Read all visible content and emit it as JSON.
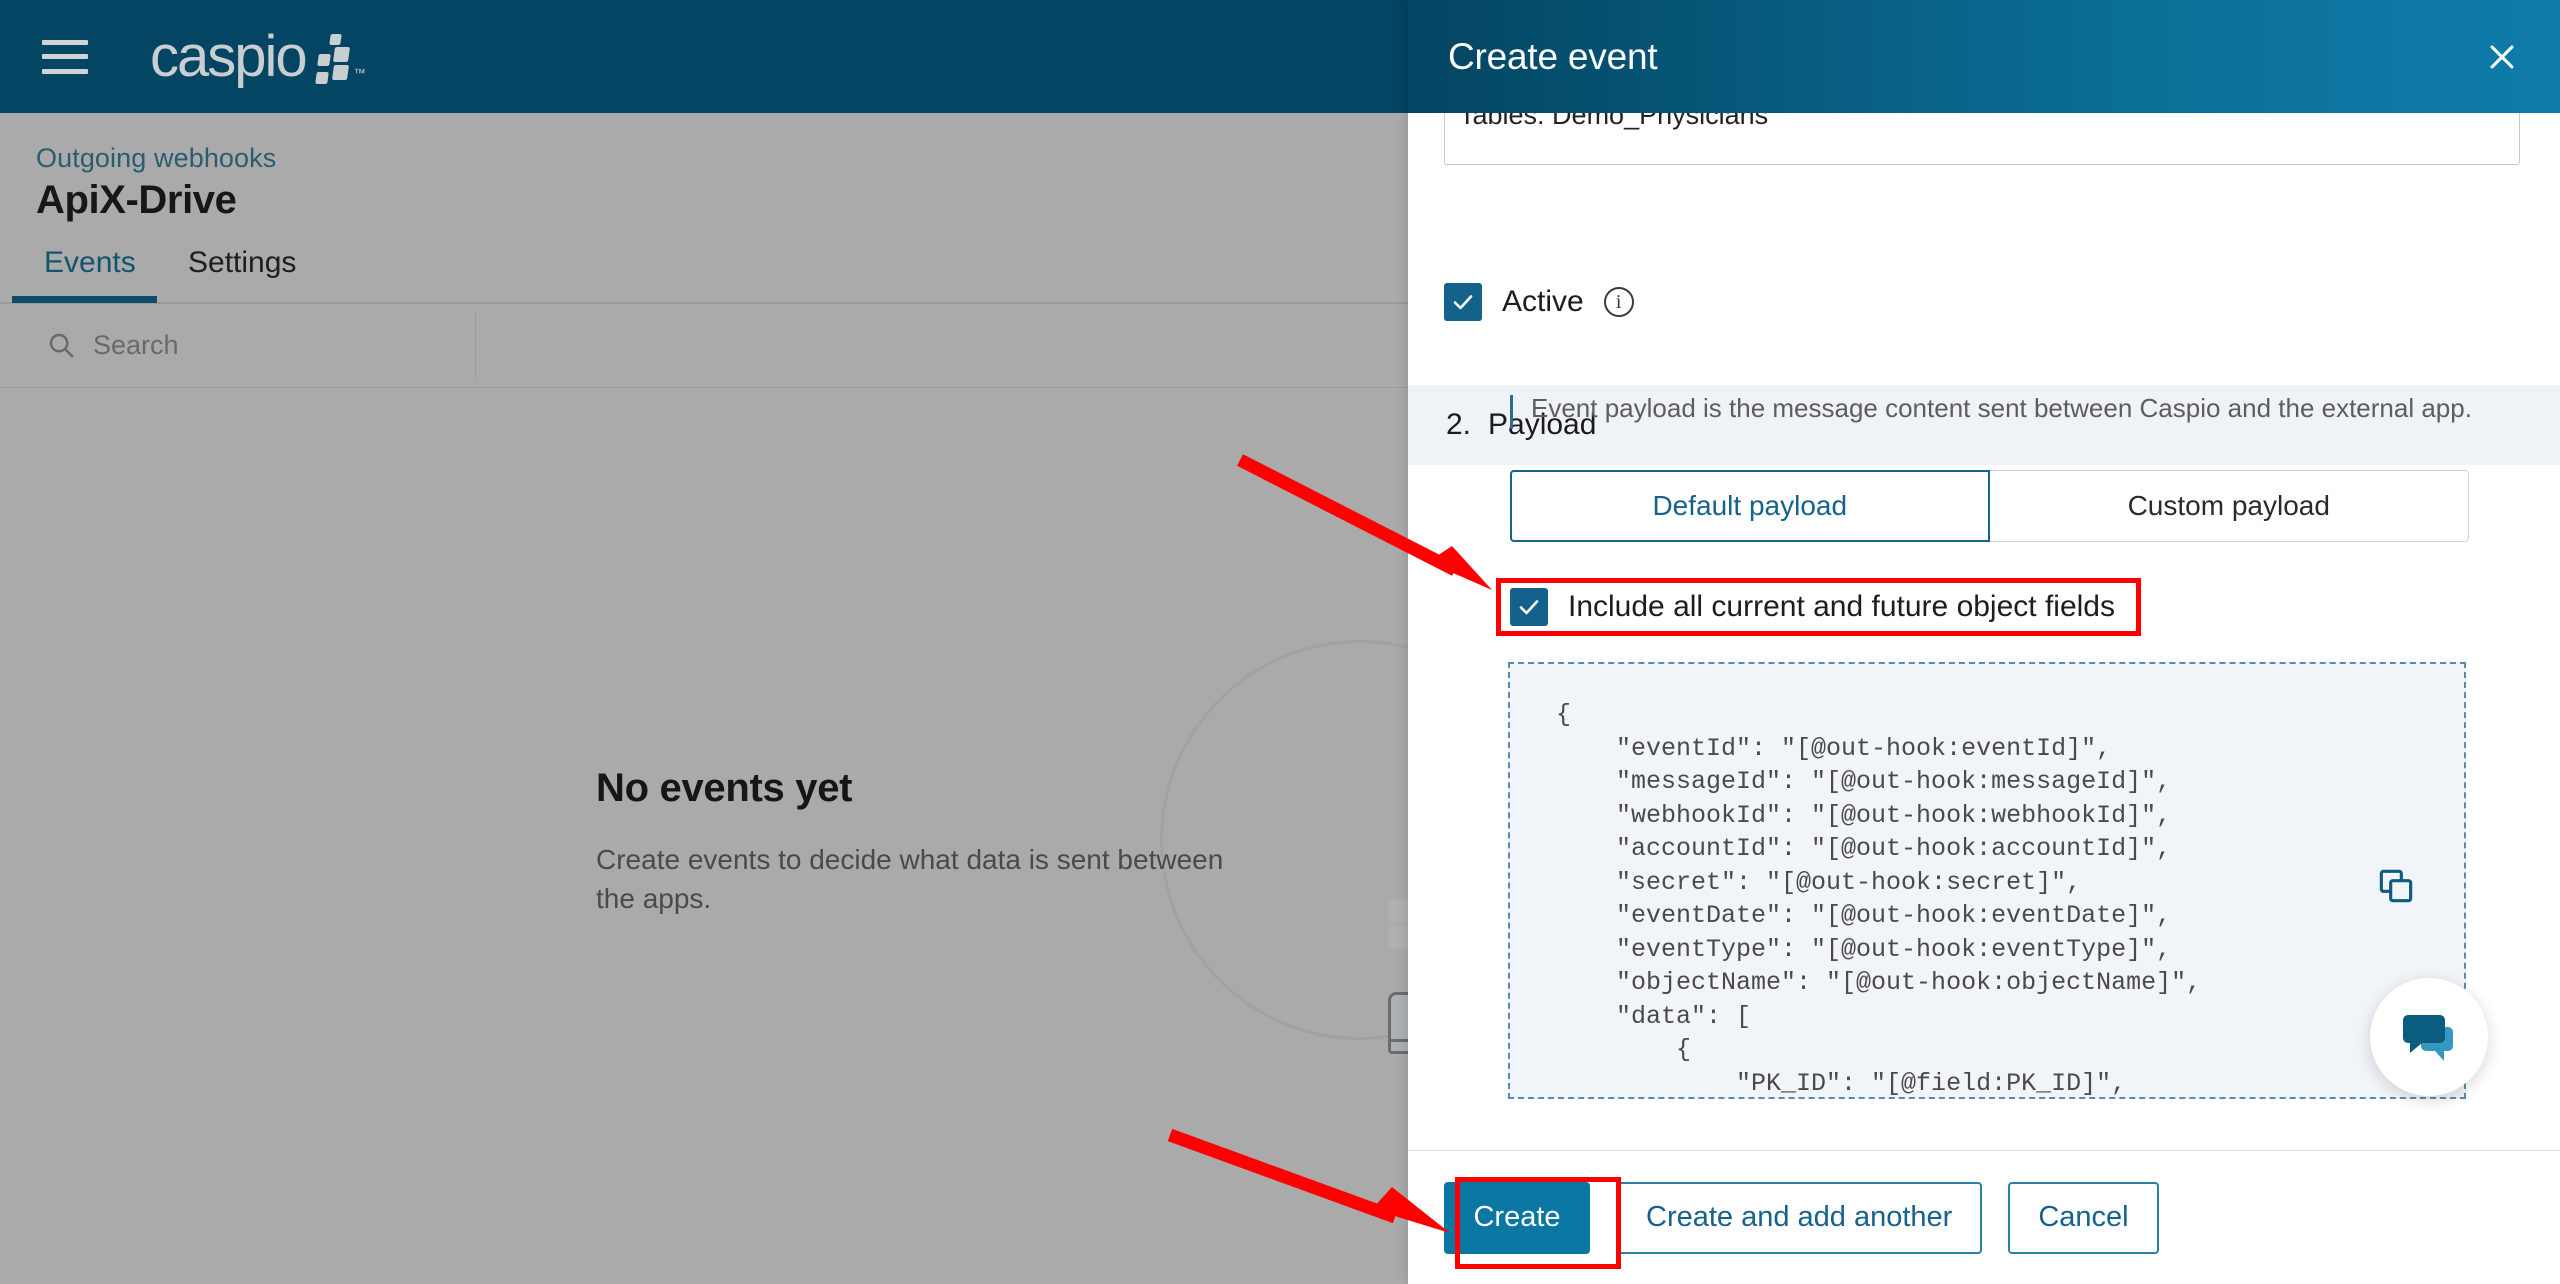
{
  "app": {
    "brand": "caspio",
    "brand_tm": "TM",
    "menu_icon": "hamburger-icon",
    "breadcrumb": "Outgoing webhooks",
    "page_title": "ApiX-Drive",
    "tabs": [
      {
        "label": "Events",
        "active": true
      },
      {
        "label": "Settings",
        "active": false
      }
    ],
    "search": {
      "placeholder": "Search",
      "value": "",
      "icon": "search-icon"
    },
    "empty_state": {
      "title": "No events yet",
      "subtitle": "Create events to decide what data is sent between the apps."
    }
  },
  "panel": {
    "title": "Create event",
    "close_icon": "close-icon",
    "clipped_field_value": "Tables: Demo_Physicians",
    "active_row": {
      "label": "Active",
      "checked": true,
      "info_icon": "info-icon",
      "info_glyph": "i"
    },
    "section": {
      "number": "2.",
      "name": "Payload",
      "hint": "Event payload is the message content sent between Caspio and the external app."
    },
    "payload_tabs": [
      {
        "label": "Default payload",
        "active": true
      },
      {
        "label": "Custom payload",
        "active": false
      }
    ],
    "include_all": {
      "label": "Include all current and future object fields",
      "checked": true
    },
    "copy_icon": "copy-icon",
    "code": "{\n    \"eventId\": \"[@out-hook:eventId]\",\n    \"messageId\": \"[@out-hook:messageId]\",\n    \"webhookId\": \"[@out-hook:webhookId]\",\n    \"accountId\": \"[@out-hook:accountId]\",\n    \"secret\": \"[@out-hook:secret]\",\n    \"eventDate\": \"[@out-hook:eventDate]\",\n    \"eventType\": \"[@out-hook:eventType]\",\n    \"objectName\": \"[@out-hook:objectName]\",\n    \"data\": [\n        {\n            \"PK_ID\": \"[@field:PK_ID]\",\n            \"Physician_ID\": \"[@field:Physician_ID]\",\n            \"Date_Created\": \"[@field:Date_Created]\"",
    "footer_buttons": [
      {
        "label": "Create",
        "style": "primary"
      },
      {
        "label": "Create and add another",
        "style": "ghost"
      },
      {
        "label": "Cancel",
        "style": "ghost"
      }
    ]
  },
  "chat_widget": {
    "icon": "chat-bubbles-icon"
  },
  "annotations": {
    "highlight_color": "#ff0000",
    "arrows": [
      {
        "target": "include-all-checkbox"
      },
      {
        "target": "create-button"
      }
    ],
    "boxes": [
      {
        "target": "include-all-checkbox-row"
      },
      {
        "target": "create-button"
      }
    ]
  },
  "colors": {
    "brand_dark": "#034562",
    "brand_teal": "#0f7cab",
    "accent": "#0a76a3",
    "panel_section_bg": "#eff3f8",
    "code_bg": "#f1f5f9",
    "annotation_red": "#ff0000"
  }
}
